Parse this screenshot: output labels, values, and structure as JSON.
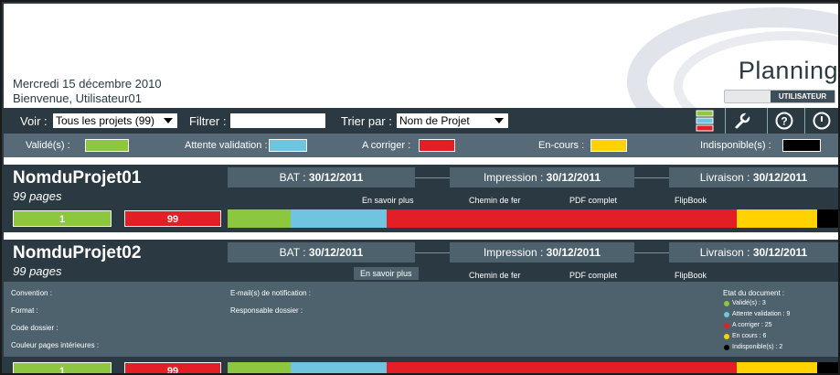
{
  "header": {
    "date": "Mercredi 15 décembre 2010",
    "welcome": "Bienvenue, Utilisateur01",
    "title": "Planning",
    "user_badge": "UTILISATEUR"
  },
  "toolbar": {
    "voir_label": "Voir :",
    "voir_value": "Tous les projets (99)",
    "filtrer_label": "Filtrer :",
    "filtrer_value": "",
    "trier_label": "Trier par :",
    "trier_value": "Nom de Projet",
    "icons": [
      "legend-icon",
      "wrench-icon",
      "help-icon",
      "power-icon"
    ]
  },
  "legend": {
    "items": [
      {
        "label": "Validé(s) :",
        "color": "#8dc63f"
      },
      {
        "label": "Attente validation :",
        "color": "#6fc5e0"
      },
      {
        "label": "A corriger :",
        "color": "#e31e24"
      },
      {
        "label": "En-cours :",
        "color": "#ffd200"
      },
      {
        "label": "Indisponible(s) :",
        "color": "#000000"
      }
    ]
  },
  "projects": [
    {
      "name": "NomduProjet01",
      "pages": "99 pages",
      "bat_label": "BAT : ",
      "bat_date": "30/12/2011",
      "impression_label": "Impression : ",
      "impression_date": "30/12/2011",
      "livraison_label": "Livraison : ",
      "livraison_date": "30/12/2011",
      "links": [
        "En savoir plus",
        "Chemin de fer",
        "PDF complet",
        "FlipBook"
      ],
      "count_valid": "1",
      "count_correct": "99",
      "progress": {
        "valide": 0.104,
        "attente": 0.157,
        "corriger": 0.574,
        "encours": 0.131,
        "indispo": 0.034
      }
    },
    {
      "name": "NomduProjet02",
      "pages": "99 pages",
      "bat_label": "BAT : ",
      "bat_date": "30/12/2011",
      "impression_label": "Impression : ",
      "impression_date": "30/12/2011",
      "livraison_label": "Livraison : ",
      "livraison_date": "30/12/2011",
      "links": [
        "En savoir plus",
        "Chemin de fer",
        "PDF complet",
        "FlipBook"
      ],
      "count_valid": "1",
      "count_correct": "99",
      "progress": {
        "valide": 0.104,
        "attente": 0.157,
        "corriger": 0.574,
        "encours": 0.131,
        "indispo": 0.034
      }
    }
  ],
  "detail": {
    "convention": "Convention :",
    "format": "Format :",
    "code": "Code dossier :",
    "couleur": "Couleur pages intérieures :",
    "email": "E-mail(s) de notification :",
    "responsable": "Responsable dossier :",
    "etat_title": "Etat du document :",
    "etat": [
      {
        "text": "Validé(s) : 3",
        "color": "#8dc63f"
      },
      {
        "text": "Attente validation : 9",
        "color": "#6fc5e0"
      },
      {
        "text": "A corriger : 25",
        "color": "#e31e24"
      },
      {
        "text": "En cours : 6",
        "color": "#ffd200"
      },
      {
        "text": "Indisponible(s) : 2",
        "color": "#000000"
      }
    ]
  }
}
